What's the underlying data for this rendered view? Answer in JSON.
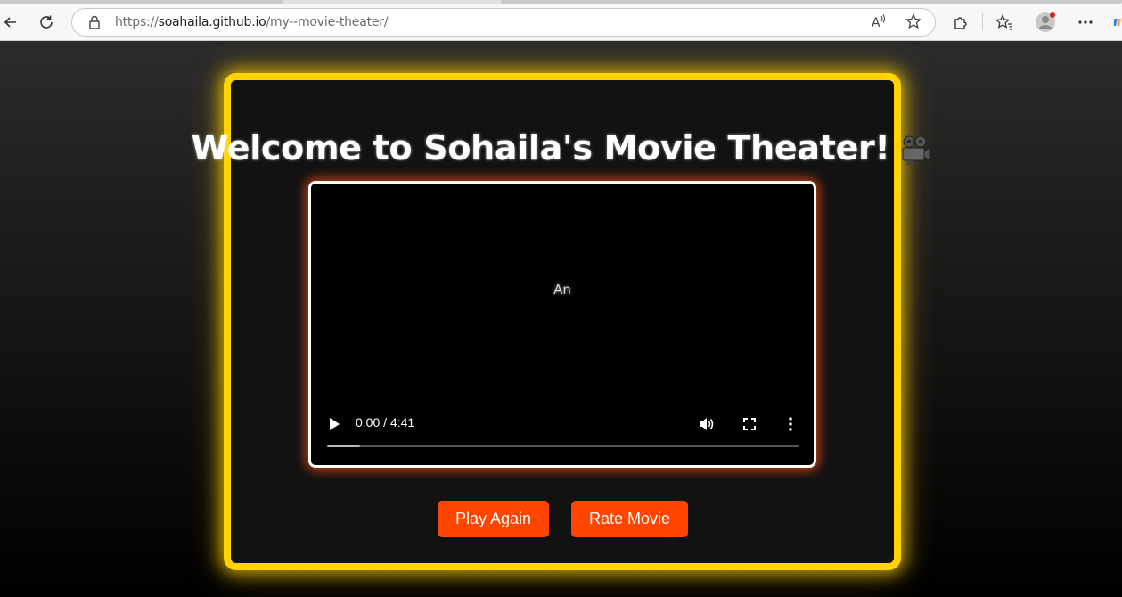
{
  "browser": {
    "url_scheme": "https://",
    "url_host": "soahaila.github.io",
    "url_path": "/my--movie-theater/"
  },
  "page": {
    "title": "Welcome to Sohaila's Movie Theater!",
    "title_icon": "movie-camera-icon"
  },
  "video": {
    "poster_text": "An",
    "time_display": "0:00 / 4:41",
    "buffered_fraction": 0.07
  },
  "buttons": {
    "play_again": "Play Again",
    "rate_movie": "Rate Movie"
  },
  "colors": {
    "frame_border": "#ffd400",
    "button_bg": "#ff4500",
    "video_glow": "#ff5014"
  }
}
